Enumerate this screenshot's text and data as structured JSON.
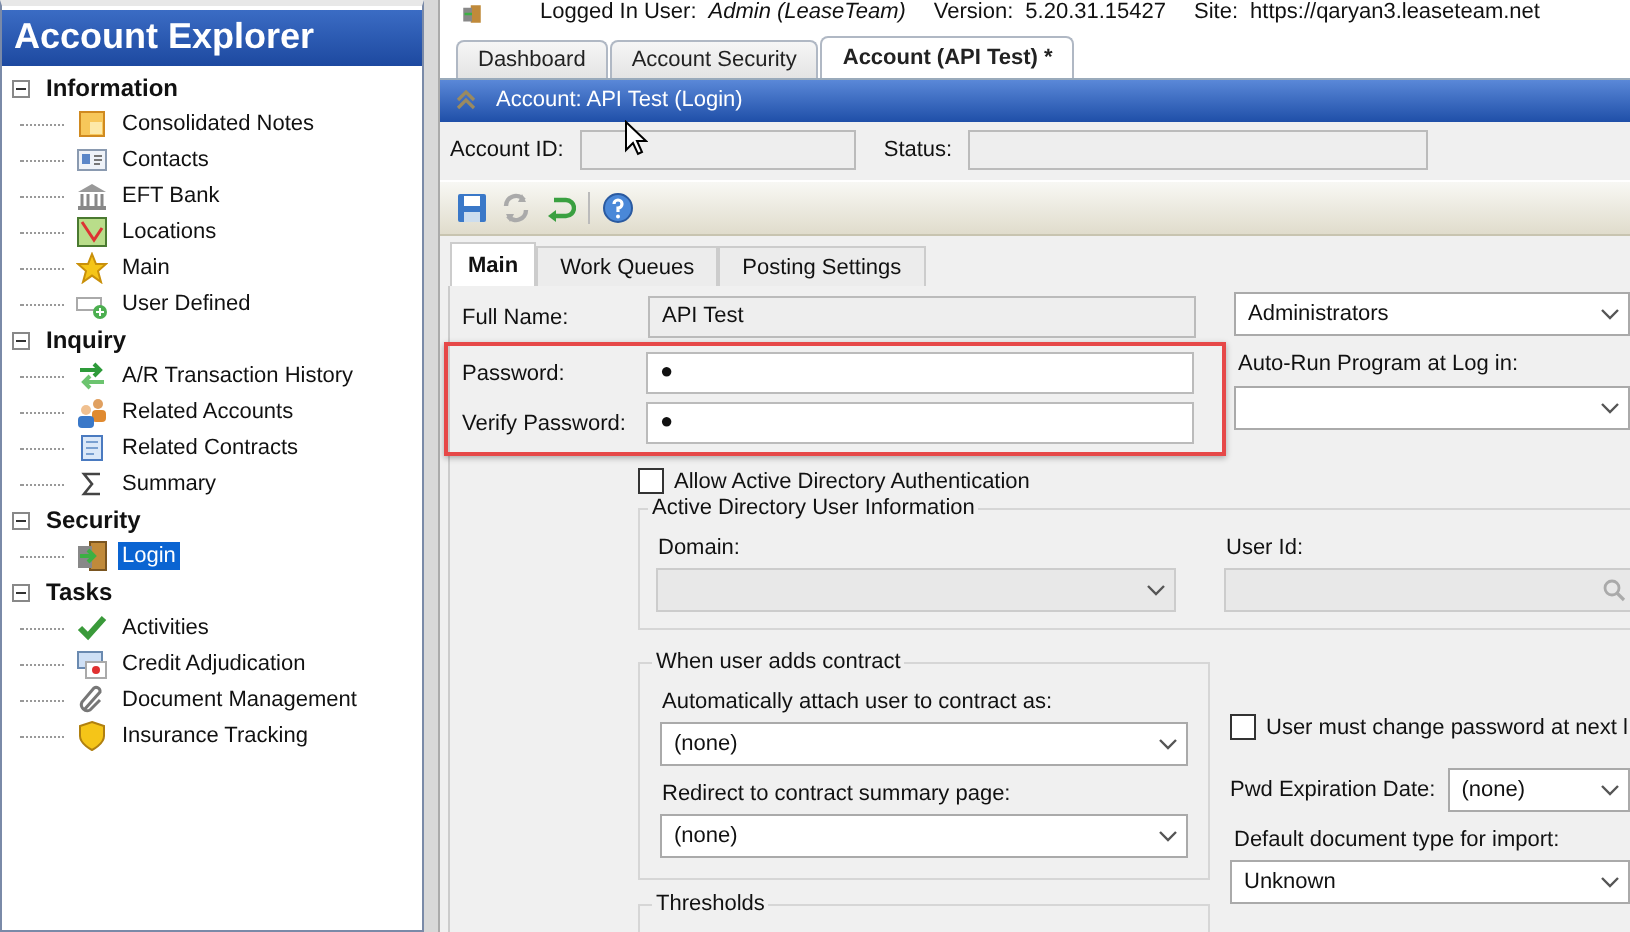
{
  "header": {
    "items": [
      {
        "label": "Logged In User:",
        "value": "Admin (LeaseTeam)"
      },
      {
        "label": "Version:",
        "value": "5.20.31.15427"
      },
      {
        "label": "Site:",
        "value": "https://qaryan3.leaseteam.net"
      }
    ]
  },
  "sidebar": {
    "title": "Account Explorer",
    "groups": [
      {
        "label": "Information",
        "expanded": true,
        "children": [
          {
            "label": "Consolidated Notes",
            "selected": false
          },
          {
            "label": "Contacts",
            "selected": false
          },
          {
            "label": "EFT Bank",
            "selected": false
          },
          {
            "label": "Locations",
            "selected": false
          },
          {
            "label": "Main",
            "selected": false
          },
          {
            "label": "User Defined",
            "selected": false
          }
        ]
      },
      {
        "label": "Inquiry",
        "expanded": true,
        "children": [
          {
            "label": "A/R Transaction History",
            "selected": false
          },
          {
            "label": "Related Accounts",
            "selected": false
          },
          {
            "label": "Related Contracts",
            "selected": false
          },
          {
            "label": "Summary",
            "selected": false
          }
        ]
      },
      {
        "label": "Security",
        "expanded": true,
        "children": [
          {
            "label": "Login",
            "selected": true
          }
        ]
      },
      {
        "label": "Tasks",
        "expanded": true,
        "children": [
          {
            "label": "Activities",
            "selected": false
          },
          {
            "label": "Credit  Adjudication",
            "selected": false
          },
          {
            "label": "Document Management",
            "selected": false
          },
          {
            "label": "Insurance Tracking",
            "selected": false
          }
        ]
      }
    ]
  },
  "tabs": [
    {
      "label": "Dashboard",
      "selected": false
    },
    {
      "label": "Account Security",
      "selected": false
    },
    {
      "label": "Account (API Test) *",
      "selected": true
    }
  ],
  "panel_title": "Account: API Test (Login)",
  "account_fields": [
    {
      "label": "Account ID:"
    },
    {
      "label": "Status:"
    }
  ],
  "subtabs": [
    {
      "label": "Main",
      "selected": true
    },
    {
      "label": "Work Queues",
      "selected": false
    },
    {
      "label": "Posting Settings",
      "selected": false
    }
  ],
  "form": {
    "full_name": {
      "label": "Full Name:",
      "value": "API Test"
    },
    "password": {
      "label": "Password:",
      "value": "●"
    },
    "verify_password": {
      "label": "Verify Password:",
      "value": "●"
    },
    "role": {
      "value": "Administrators"
    },
    "auto_run": {
      "label": "Auto-Run Program at Log in:"
    },
    "allow_ad": {
      "label": "Allow Active Directory Authentication",
      "checked": false
    },
    "ad_group": {
      "title": "Active Directory User Information",
      "domain_label": "Domain:",
      "user_id_label": "User Id:"
    },
    "contract_group": {
      "title": "When user adds contract",
      "fields": [
        {
          "label": "Automatically attach user to contract as:",
          "value": "(none)"
        },
        {
          "label": "Redirect to contract summary page:",
          "value": "(none)"
        }
      ]
    },
    "thresholds": {
      "title": "Thresholds"
    },
    "must_change": {
      "label": "User must change password at next l",
      "checked": false
    },
    "pwd_expiration": {
      "label": "Pwd Expiration Date:",
      "value": "(none)"
    },
    "default_doc": {
      "label": "Default document type for import:",
      "value": "Unknown"
    }
  }
}
